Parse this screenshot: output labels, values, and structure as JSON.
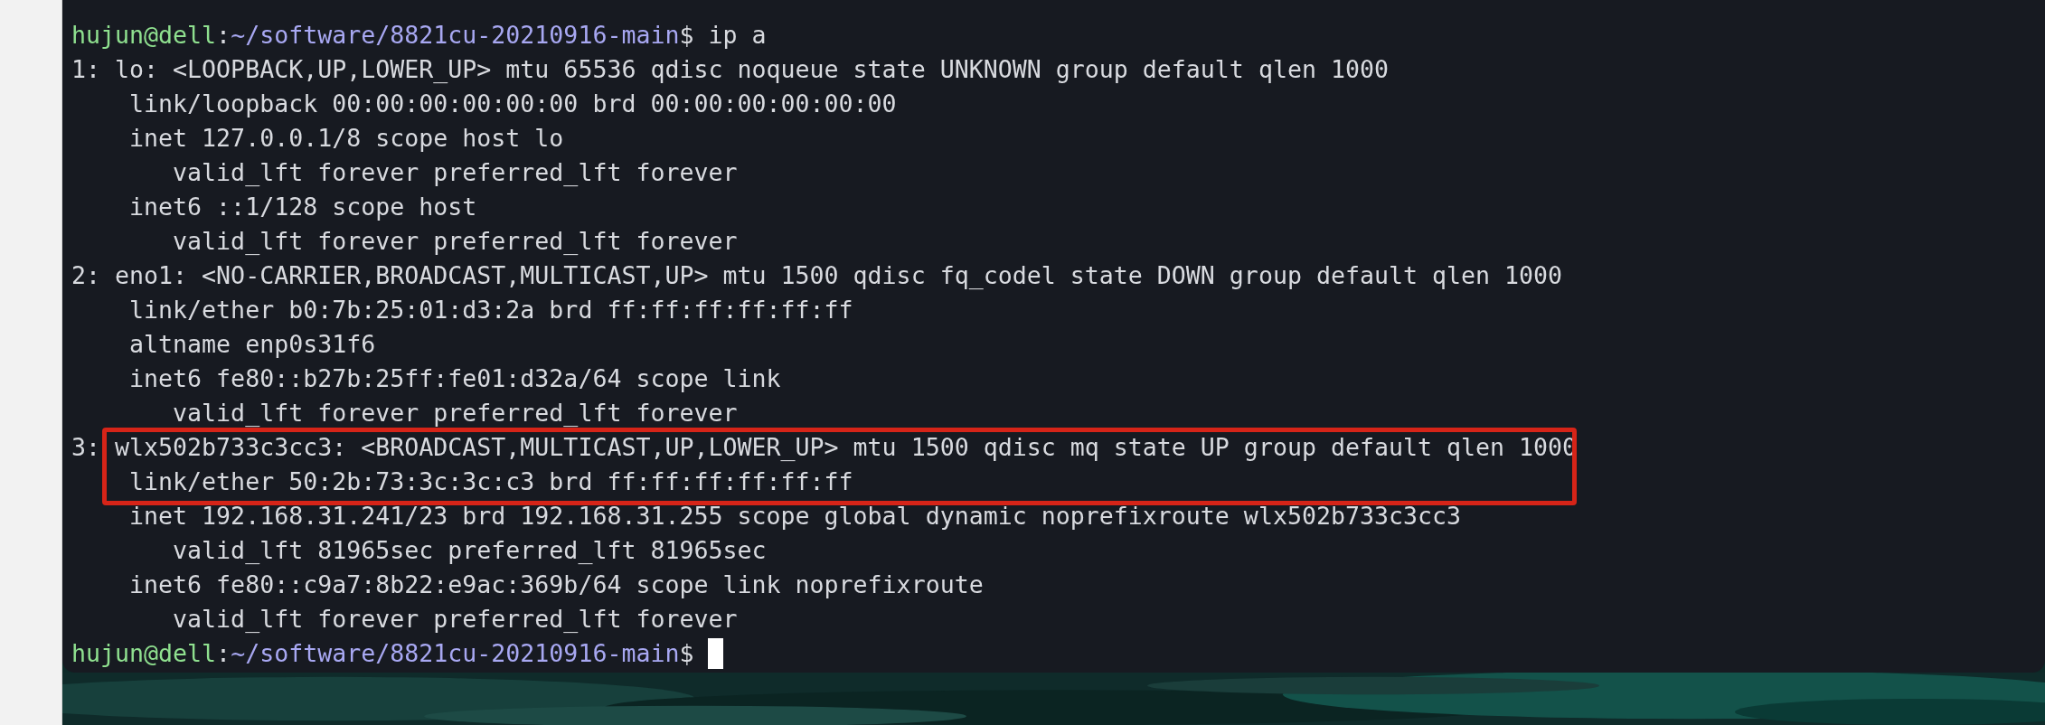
{
  "terminal": {
    "lines": [
      {
        "kind": "prompt",
        "user_host": "hujun@dell",
        "separator": ":",
        "path": "~/software/8821cu-20210916-main",
        "symbol": "$",
        "command": "ip a",
        "cursor": false
      },
      {
        "kind": "output",
        "text": "1: lo: <LOOPBACK,UP,LOWER_UP> mtu 65536 qdisc noqueue state UNKNOWN group default qlen 1000",
        "highlighted": false
      },
      {
        "kind": "output",
        "text": "    link/loopback 00:00:00:00:00:00 brd 00:00:00:00:00:00",
        "highlighted": false
      },
      {
        "kind": "output",
        "text": "    inet 127.0.0.1/8 scope host lo",
        "highlighted": false
      },
      {
        "kind": "output",
        "text": "       valid_lft forever preferred_lft forever",
        "highlighted": false
      },
      {
        "kind": "output",
        "text": "    inet6 ::1/128 scope host",
        "highlighted": false
      },
      {
        "kind": "output",
        "text": "       valid_lft forever preferred_lft forever",
        "highlighted": false
      },
      {
        "kind": "output",
        "text": "2: eno1: <NO-CARRIER,BROADCAST,MULTICAST,UP> mtu 1500 qdisc fq_codel state DOWN group default qlen 1000",
        "highlighted": false
      },
      {
        "kind": "output",
        "text": "    link/ether b0:7b:25:01:d3:2a brd ff:ff:ff:ff:ff:ff",
        "highlighted": false
      },
      {
        "kind": "output",
        "text": "    altname enp0s31f6",
        "highlighted": false
      },
      {
        "kind": "output",
        "text": "    inet6 fe80::b27b:25ff:fe01:d32a/64 scope link",
        "highlighted": false
      },
      {
        "kind": "output",
        "text": "       valid_lft forever preferred_lft forever",
        "highlighted": false
      },
      {
        "kind": "output",
        "text": "3: wlx502b733c3cc3: <BROADCAST,MULTICAST,UP,LOWER_UP> mtu 1500 qdisc mq state UP group default qlen 1000",
        "highlighted": true
      },
      {
        "kind": "output",
        "text": "    link/ether 50:2b:73:3c:3c:c3 brd ff:ff:ff:ff:ff:ff",
        "highlighted": true
      },
      {
        "kind": "output",
        "text": "    inet 192.168.31.241/23 brd 192.168.31.255 scope global dynamic noprefixroute wlx502b733c3cc3",
        "highlighted": false
      },
      {
        "kind": "output",
        "text": "       valid_lft 81965sec preferred_lft 81965sec",
        "highlighted": false
      },
      {
        "kind": "output",
        "text": "    inet6 fe80::c9a7:8b22:e9ac:369b/64 scope link noprefixroute",
        "highlighted": false
      },
      {
        "kind": "output",
        "text": "       valid_lft forever preferred_lft forever",
        "highlighted": false
      },
      {
        "kind": "prompt",
        "user_host": "hujun@dell",
        "separator": ":",
        "path": "~/software/8821cu-20210916-main",
        "symbol": "$",
        "cursor": true
      }
    ]
  }
}
